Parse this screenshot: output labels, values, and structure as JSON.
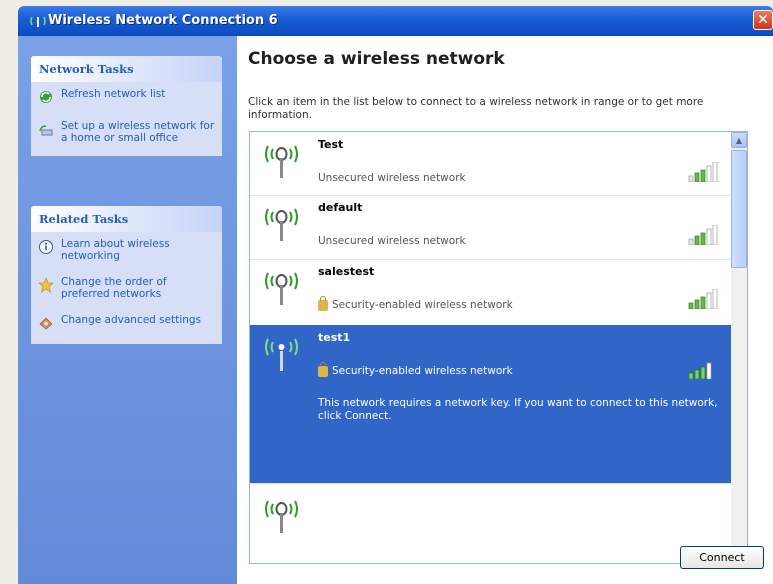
{
  "window": {
    "title": "Wireless Network Connection 6",
    "close_label": "✕"
  },
  "left_pane": {
    "network_tasks": {
      "header": "Network Tasks",
      "items": [
        {
          "icon": "refresh-icon",
          "label": "Refresh network list"
        },
        {
          "icon": "setup-network-icon",
          "label": "Set up a wireless network for a home or small office"
        }
      ]
    },
    "related_tasks": {
      "header": "Related Tasks",
      "items": [
        {
          "icon": "info-icon",
          "label": "Learn about wireless networking"
        },
        {
          "icon": "star-icon",
          "label": "Change the order of preferred networks"
        },
        {
          "icon": "settings-icon",
          "label": "Change advanced settings"
        }
      ]
    }
  },
  "main": {
    "heading": "Choose a wireless network",
    "instructions": "Click an item in the list below to connect to a wireless network in range or to get more information.",
    "networks": [
      {
        "ssid": "Test",
        "security": "Unsecured wireless network",
        "secured": false,
        "signal": "excellent"
      },
      {
        "ssid": "default",
        "security": "Unsecured wireless network",
        "secured": false,
        "signal": "excellent"
      },
      {
        "ssid": "salestest",
        "security": "Security-enabled wireless network",
        "secured": true,
        "signal": "excellent"
      },
      {
        "ssid": "test1",
        "security": "Security-enabled wireless network",
        "secured": true,
        "signal": "very-good",
        "selected": true,
        "message": "This network requires a network key. If you want to connect to this network, click Connect."
      },
      {
        "ssid": "",
        "security": "",
        "secured": false,
        "signal": "low"
      }
    ],
    "connect_label": "Connect"
  },
  "colors": {
    "titlebar": "#1a5fd6",
    "task_pane": "#6d94dd",
    "selection": "#3166c8",
    "link_text": "#215dc6"
  }
}
